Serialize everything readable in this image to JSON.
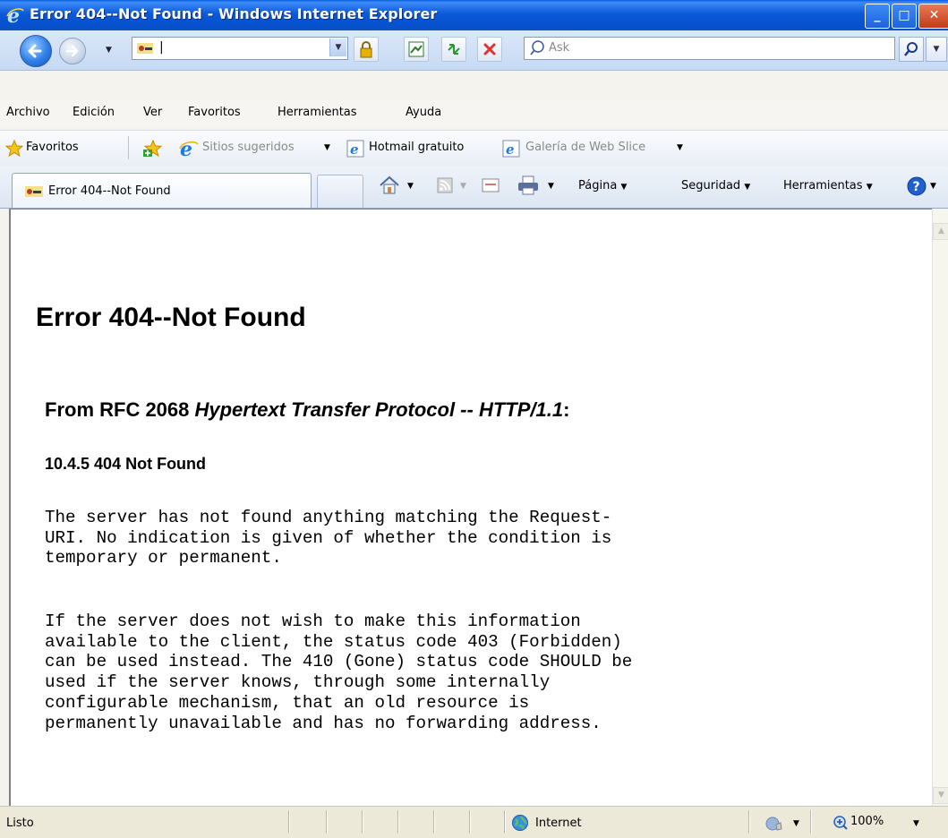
{
  "window": {
    "title": "Error 404--Not Found - Windows Internet Explorer"
  },
  "address_bar": {
    "value": "|"
  },
  "search": {
    "placeholder": "Ask"
  },
  "menu": {
    "items": [
      "Archivo",
      "Edición",
      "Ver",
      "Favoritos",
      "Herramientas",
      "Ayuda"
    ]
  },
  "favorites_bar": {
    "favorites_label": "Favoritos",
    "suggested_sites": "Sitios sugeridos",
    "hotmail": "Hotmail gratuito",
    "web_slice": "Galería de Web Slice"
  },
  "tabs": {
    "active_label": "Error 404--Not Found"
  },
  "command_bar": {
    "page": "Página",
    "security": "Seguridad",
    "tools": "Herramientas"
  },
  "page": {
    "heading": "Error 404--Not Found",
    "subheading_prefix": "From RFC 2068 ",
    "subheading_italic": "Hypertext Transfer Protocol -- HTTP/1.1",
    "subheading_suffix": ":",
    "section": "10.4.5 404 Not Found",
    "paragraph1": "The server has not found anything matching the Request-\nURI. No indication is given of whether the condition is\ntemporary or permanent.",
    "paragraph2": "If the server does not wish to make this information\navailable to the client, the status code 403 (Forbidden)\ncan be used instead. The 410 (Gone) status code SHOULD be\nused if the server knows, through some internally\nconfigurable mechanism, that an old resource is\npermanently unavailable and has no forwarding address."
  },
  "status_bar": {
    "status": "Listo",
    "zone": "Internet",
    "zoom": "100%"
  },
  "colors": {
    "titlebar": "#0653d2",
    "close_button": "#c43b17"
  }
}
